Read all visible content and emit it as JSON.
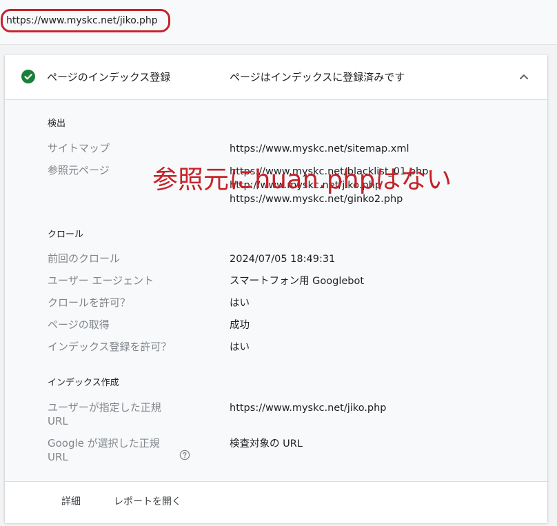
{
  "url_bar": {
    "url": "https://www.myskc.net/jiko.php"
  },
  "header": {
    "title": "ページのインデックス登録",
    "status": "ページはインデックスに登録済みです"
  },
  "discovery": {
    "heading": "検出",
    "sitemap_label": "サイトマップ",
    "sitemap_value": "https://www.myskc.net/sitemap.xml",
    "referring_label": "参照元ページ",
    "referring_pages": [
      "https://www.myskc.net/blacklist_01.php",
      "http://www.myskc.net/jiko.php",
      "https://www.myskc.net/ginko2.php"
    ]
  },
  "crawl": {
    "heading": "クロール",
    "rows": [
      {
        "label": "前回のクロール",
        "value": "2024/07/05 18:49:31"
      },
      {
        "label": "ユーザー エージェント",
        "value": "スマートフォン用 Googlebot"
      },
      {
        "label": "クロールを許可？",
        "value": "はい"
      },
      {
        "label": "ページの取得",
        "value": "成功"
      },
      {
        "label": "インデックス登録を許可？",
        "value": "はい"
      }
    ]
  },
  "indexing": {
    "heading": "インデックス作成",
    "user_canonical_label_1": "ユーザーが指定した正規",
    "user_canonical_label_2": "URL",
    "user_canonical_value": "https://www.myskc.net/jiko.php",
    "google_canonical_label_1": "Google が選択した正規",
    "google_canonical_label_2": "URL",
    "google_canonical_value": "検査対象の URL"
  },
  "annotation": "参照元にhuan.phpはない",
  "footer": {
    "details_label": "詳細",
    "open_report_label": "レポートを開く"
  },
  "icons": {
    "check": "check-circle-icon",
    "chevron": "chevron-up-icon",
    "help": "help-circle-icon"
  },
  "colors": {
    "success_green": "#188038",
    "annotation_red": "#c5232a"
  }
}
